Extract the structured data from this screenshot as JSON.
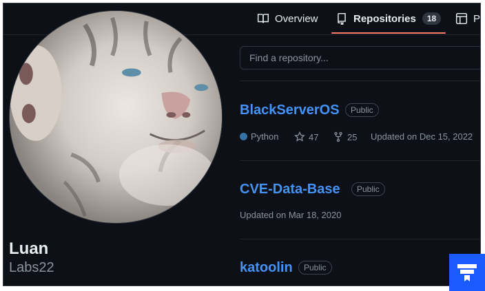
{
  "nav": {
    "overview_label": "Overview",
    "repositories_label": "Repositories",
    "repositories_count": "18",
    "projects_label": "P"
  },
  "profile": {
    "name": "Luan",
    "username": "Labs22"
  },
  "search": {
    "placeholder": "Find a repository..."
  },
  "repos": [
    {
      "name": "BlackServerOS",
      "visibility": "Public",
      "language": "Python",
      "stars": "47",
      "forks": "25",
      "updated": "Updated on Dec 15, 2022"
    },
    {
      "name": "CVE-Data-Base",
      "visibility": "Public",
      "updated": "Updated on Mar 18, 2020"
    },
    {
      "name": "katoolin",
      "visibility": "Public"
    }
  ],
  "colors": {
    "background": "#0d1117",
    "link": "#4493f8",
    "tab_underline": "#f78166",
    "python": "#3572a5"
  }
}
